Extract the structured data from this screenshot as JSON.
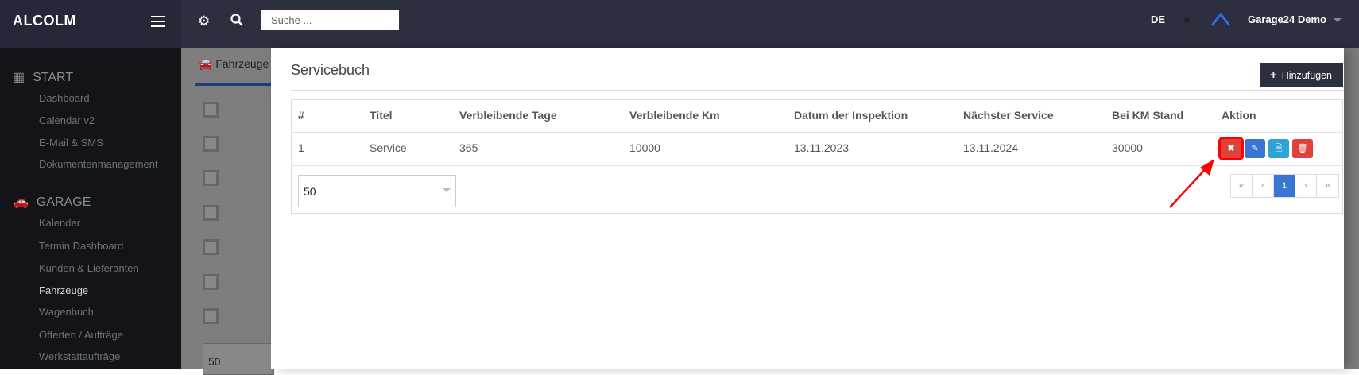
{
  "app": {
    "brand": "ALCOLM",
    "search_placeholder": "Suche ...",
    "language": "DE",
    "user": "Garage24 Demo"
  },
  "sidebar": {
    "sections": [
      {
        "label": "START",
        "icon": "grid-icon",
        "items": [
          "Dashboard",
          "Calendar v2",
          "E-Mail & SMS",
          "Dokumentenmanagement"
        ]
      },
      {
        "label": "GARAGE",
        "icon": "cars-icon",
        "items": [
          "Kalender",
          "Termin Dashboard",
          "Kunden & Lieferanten",
          "Fahrzeuge",
          "Wagenbuch",
          "Offerten / Aufträge",
          "Werkstattaufträge"
        ]
      }
    ],
    "active": "Fahrzeuge"
  },
  "background": {
    "tab": "Fahrzeuge",
    "page_size": "50"
  },
  "modal": {
    "title": "Servicebuch",
    "add_label": "Hinzufügen",
    "columns": [
      "#",
      "Titel",
      "Verbleibende Tage",
      "Verbleibende Km",
      "Datum der Inspektion",
      "Nächster Service",
      "Bei KM Stand",
      "Aktion"
    ],
    "rows": [
      [
        "1",
        "Service",
        "365",
        "10000",
        "13.11.2023",
        "13.11.2024",
        "30000"
      ]
    ],
    "actions": [
      {
        "icon": "close-icon",
        "color": "#e0413a"
      },
      {
        "icon": "pencil-icon",
        "color": "#3b75d4"
      },
      {
        "icon": "file-icon",
        "color": "#2fa2d6"
      },
      {
        "icon": "trash-icon",
        "color": "#e0413a"
      }
    ],
    "page_size": "50",
    "pagination": [
      "«",
      "‹",
      "1",
      "›",
      "»"
    ],
    "current_page": "1"
  },
  "colors": {
    "topbar": "#2c2f3e",
    "sidebar": "#131419",
    "accent": "#3b75d4",
    "danger": "#e0413a",
    "annotation": "#ff0000"
  }
}
